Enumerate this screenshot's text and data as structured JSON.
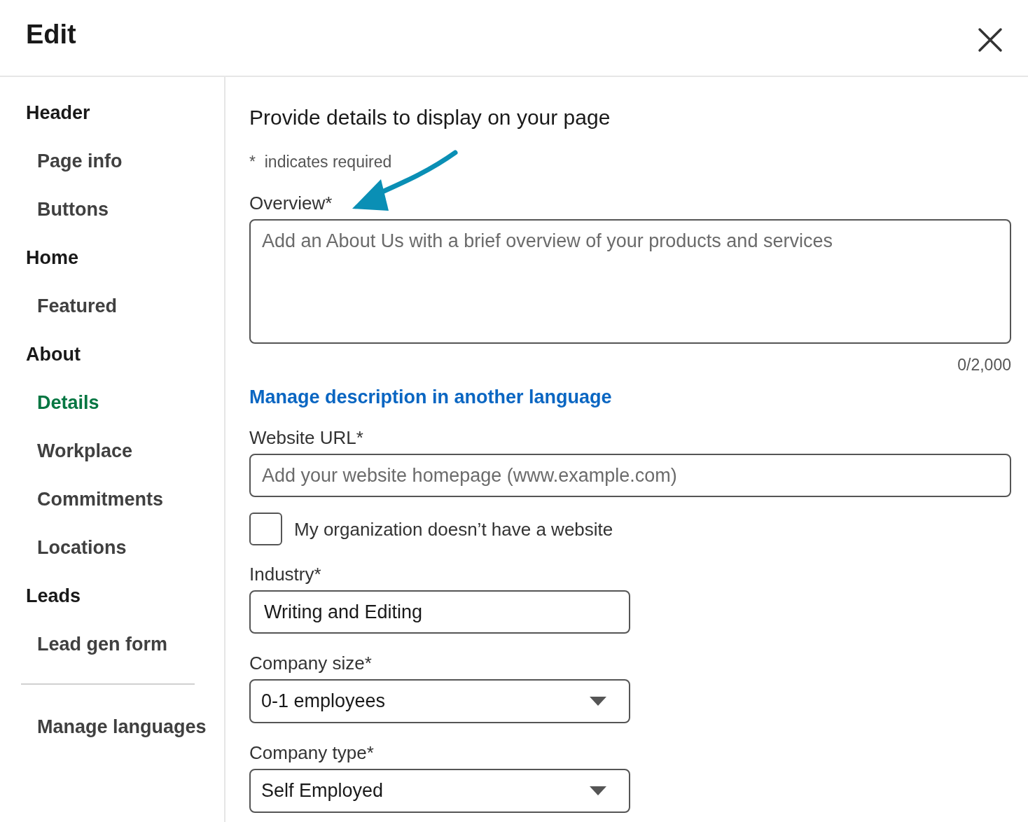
{
  "dialog": {
    "title": "Edit"
  },
  "sidebar": {
    "items": [
      {
        "label": "Header",
        "selected": false,
        "children": [
          {
            "label": "Page info",
            "selected": false
          },
          {
            "label": "Buttons",
            "selected": false
          }
        ]
      },
      {
        "label": "Home",
        "selected": false,
        "children": [
          {
            "label": "Featured",
            "selected": false
          }
        ]
      },
      {
        "label": "About",
        "selected": false,
        "children": [
          {
            "label": "Details",
            "selected": true
          },
          {
            "label": "Workplace",
            "selected": false
          },
          {
            "label": "Commitments",
            "selected": false
          },
          {
            "label": "Locations",
            "selected": false
          }
        ]
      },
      {
        "label": "Leads",
        "selected": false,
        "children": [
          {
            "label": "Lead gen form",
            "selected": false
          }
        ]
      }
    ],
    "footer_items": [
      {
        "label": "Manage languages",
        "selected": false
      }
    ]
  },
  "form": {
    "heading": "Provide details to display on your page",
    "required_note": "*  indicates required",
    "fields": [
      {
        "kind": "textarea",
        "label": "Overview*",
        "placeholder": "Add an About Us with a brief overview of your products and services",
        "counter": "0/2,000"
      },
      {
        "kind": "link",
        "text": "Manage description in another language"
      },
      {
        "kind": "text",
        "label": "Website URL*",
        "placeholder": "Add your website homepage (www.example.com)"
      },
      {
        "kind": "checkbox",
        "text": "My organization doesn’t have a website",
        "checked": false
      },
      {
        "kind": "typeahead",
        "label": "Industry*",
        "value": "Writing and Editing"
      },
      {
        "kind": "select",
        "label": "Company size*",
        "value": "0-1 employees"
      },
      {
        "kind": "select",
        "label": "Company type*",
        "value": "Self Employed"
      }
    ]
  }
}
